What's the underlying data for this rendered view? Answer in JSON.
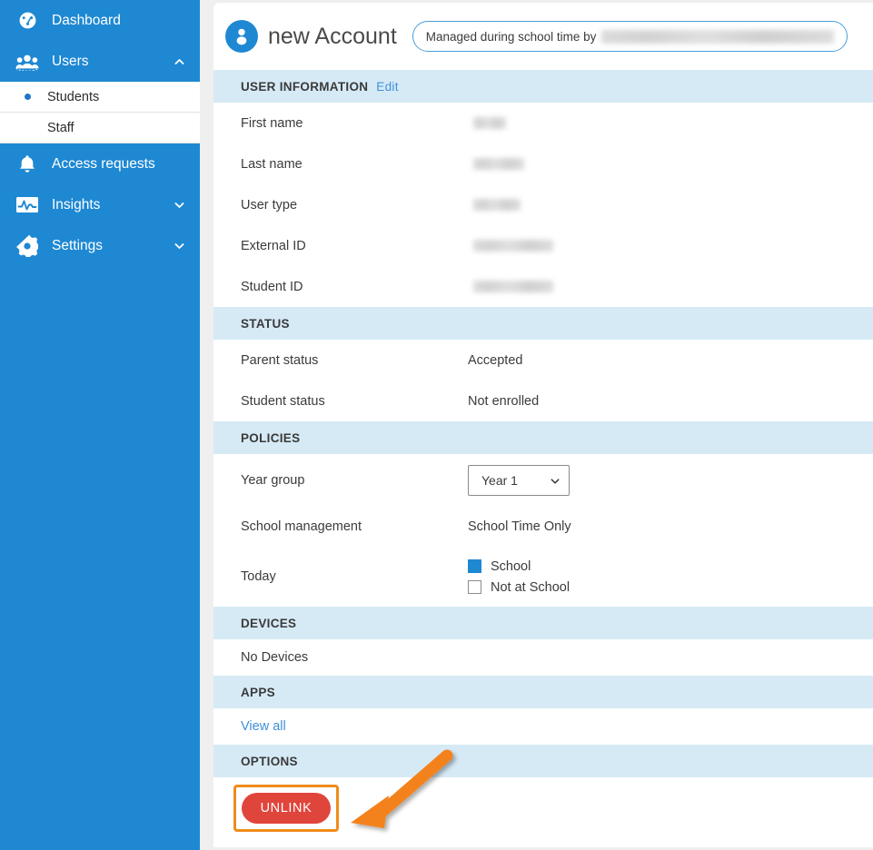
{
  "sidebar": {
    "items": [
      {
        "label": "Dashboard",
        "icon": "dashboard-icon",
        "expandable": false
      },
      {
        "label": "Users",
        "icon": "users-icon",
        "expandable": true,
        "chevron": "chevron-up-icon",
        "expanded": true
      },
      {
        "label": "Access requests",
        "icon": "bell-icon",
        "expandable": false
      },
      {
        "label": "Insights",
        "icon": "insights-icon",
        "expandable": true,
        "chevron": "chevron-down-icon",
        "expanded": false
      },
      {
        "label": "Settings",
        "icon": "gear-icon",
        "expandable": true,
        "chevron": "chevron-down-icon",
        "expanded": false
      }
    ],
    "sub_items": [
      {
        "label": "Students",
        "selected": true
      },
      {
        "label": "Staff",
        "selected": false
      }
    ]
  },
  "header": {
    "avatar_icon": "user-avatar-icon",
    "title": "new Account",
    "managed_prefix": "Managed during school time by",
    "managed_org": ""
  },
  "sections": {
    "user_information": {
      "title": "USER INFORMATION",
      "edit_label": "Edit",
      "rows": [
        {
          "label": "First name",
          "value": "",
          "redacted": true
        },
        {
          "label": "Last name",
          "value": "",
          "redacted": true
        },
        {
          "label": "User type",
          "value": "",
          "redacted": true
        },
        {
          "label": "External ID",
          "value": "",
          "redacted": true
        },
        {
          "label": "Student ID",
          "value": "",
          "redacted": true
        }
      ]
    },
    "status": {
      "title": "STATUS",
      "rows": [
        {
          "label": "Parent status",
          "value": "Accepted"
        },
        {
          "label": "Student status",
          "value": "Not enrolled"
        }
      ]
    },
    "policies": {
      "title": "POLICIES",
      "year_group": {
        "label": "Year group",
        "value": "Year 1",
        "chevron": "chevron-down-icon"
      },
      "school_management": {
        "label": "School management",
        "value": "School Time Only"
      },
      "today": {
        "label": "Today",
        "options": [
          {
            "label": "School",
            "checked": true
          },
          {
            "label": "Not at School",
            "checked": false
          }
        ]
      }
    },
    "devices": {
      "title": "DEVICES",
      "empty_text": "No Devices"
    },
    "apps": {
      "title": "APPS",
      "view_all_label": "View all"
    },
    "options": {
      "title": "OPTIONS",
      "unlink_label": "UNLINK"
    }
  },
  "annotations": {
    "arrow": {
      "name": "callout-arrow",
      "color": "#f4821f",
      "points_to": "unlink-button"
    },
    "highlight_box": {
      "name": "callout-highlight-box",
      "color": "#f08c1a"
    }
  },
  "colors": {
    "sidebar": "#1e88d3",
    "section_band": "#d6eaf6",
    "accent_link": "#3e90d8",
    "danger": "#e0453c",
    "callout": "#f4821f"
  }
}
